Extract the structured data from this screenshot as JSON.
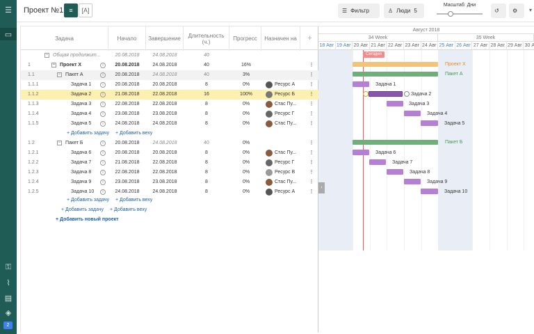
{
  "sidebar": {
    "badge": "2"
  },
  "header": {
    "title": "Проект №1",
    "filter_label": "Фильтр",
    "people_label": "Люди",
    "people_count": "5",
    "scale_label": "Масштаб: Дни",
    "scale_level": 0.3
  },
  "columns": {
    "task": "Задача",
    "start": "Начало",
    "end": "Завершение",
    "duration": "Длительность (ч.)",
    "progress": "Прогресс",
    "assigned": "Назначен на",
    "add": "+"
  },
  "summary": {
    "name": "Общая продолжит...",
    "start": "20.08.2018",
    "end": "24.08.2018",
    "duration": "40"
  },
  "rows": [
    {
      "wbs": "1",
      "name": "Проект X",
      "start": "20.08.2018",
      "end": "24.08.2018",
      "duration": "40",
      "progress": "16%",
      "resource": ""
    },
    {
      "wbs": "1.1",
      "name": "Пакет А",
      "start": "20.08.2018",
      "end": "24.08.2018",
      "duration": "40",
      "progress": "3%",
      "resource": ""
    },
    {
      "wbs": "1.1.1",
      "name": "Задача 1",
      "start": "20.08.2018",
      "end": "20.08.2018",
      "duration": "8",
      "progress": "0%",
      "resource": "Ресурс А"
    },
    {
      "wbs": "1.1.2",
      "name": "Задача 2",
      "start": "21.08.2018",
      "end": "22.08.2018",
      "duration": "16",
      "progress": "100%",
      "resource": "Ресурс Б"
    },
    {
      "wbs": "1.1.3",
      "name": "Задача 3",
      "start": "22.08.2018",
      "end": "22.08.2018",
      "duration": "8",
      "progress": "0%",
      "resource": "Стас Пу..."
    },
    {
      "wbs": "1.1.4",
      "name": "Задача 4",
      "start": "23.08.2018",
      "end": "23.08.2018",
      "duration": "8",
      "progress": "0%",
      "resource": "Ресурс Г"
    },
    {
      "wbs": "1.1.5",
      "name": "Задача 5",
      "start": "24.08.2018",
      "end": "24.08.2018",
      "duration": "8",
      "progress": "0%",
      "resource": "Стас Пу..."
    },
    {
      "wbs": "1.2",
      "name": "Пакет Б",
      "start": "20.08.2018",
      "end": "24.08.2018",
      "duration": "40",
      "progress": "0%",
      "resource": ""
    },
    {
      "wbs": "1.2.1",
      "name": "Задача 6",
      "start": "20.08.2018",
      "end": "20.08.2018",
      "duration": "8",
      "progress": "0%",
      "resource": "Стас Пу..."
    },
    {
      "wbs": "1.2.2",
      "name": "Задача 7",
      "start": "21.08.2018",
      "end": "22.08.2018",
      "duration": "8",
      "progress": "0%",
      "resource": "Ресурс Г"
    },
    {
      "wbs": "1.2.3",
      "name": "Задача 8",
      "start": "22.08.2018",
      "end": "22.08.2018",
      "duration": "8",
      "progress": "0%",
      "resource": "Ресурс В"
    },
    {
      "wbs": "1.2.4",
      "name": "Задача 9",
      "start": "23.08.2018",
      "end": "23.08.2018",
      "duration": "8",
      "progress": "0%",
      "resource": "Стас Пу..."
    },
    {
      "wbs": "1.2.5",
      "name": "Задача 10",
      "start": "24.08.2018",
      "end": "24.08.2018",
      "duration": "8",
      "progress": "0%",
      "resource": "Ресурс А"
    }
  ],
  "links": {
    "add_task": "+ Добавить задачу",
    "add_milestone": "+ Добавить веху",
    "add_project": "+ Добавить новый проект"
  },
  "timeline": {
    "month": "Август 2018",
    "weeks": [
      "34 Week",
      "35 Week"
    ],
    "days": [
      "18 Авг",
      "19 Авг",
      "20 Авг",
      "21 Авг",
      "22 Авг",
      "23 Авг",
      "24 Авг",
      "25 Авг",
      "26 Авг",
      "27 Авг",
      "28 Авг",
      "29 Авг",
      "30 Авг"
    ],
    "today_label": "Сегодня",
    "bar_labels": {
      "project": "Проект X",
      "pkgA": "Пакет А",
      "pkgB": "Пакет Б",
      "t1": "Задача 1",
      "t2": "Задача 2",
      "t3": "Задача 3",
      "t4": "Задача 4",
      "t5": "Задача 5",
      "t6": "Задача 6",
      "t7": "Задача 7",
      "t8": "Задача 8",
      "t9": "Задача 9",
      "t10": "Задача 10"
    }
  },
  "colors": {
    "accent": "#1f5c56",
    "task_bar": "#b57fd6",
    "project_bar": "#f5c27a",
    "package_bar": "#6fb07a",
    "highlight": "#fdf0b0",
    "today": "#e55555"
  }
}
